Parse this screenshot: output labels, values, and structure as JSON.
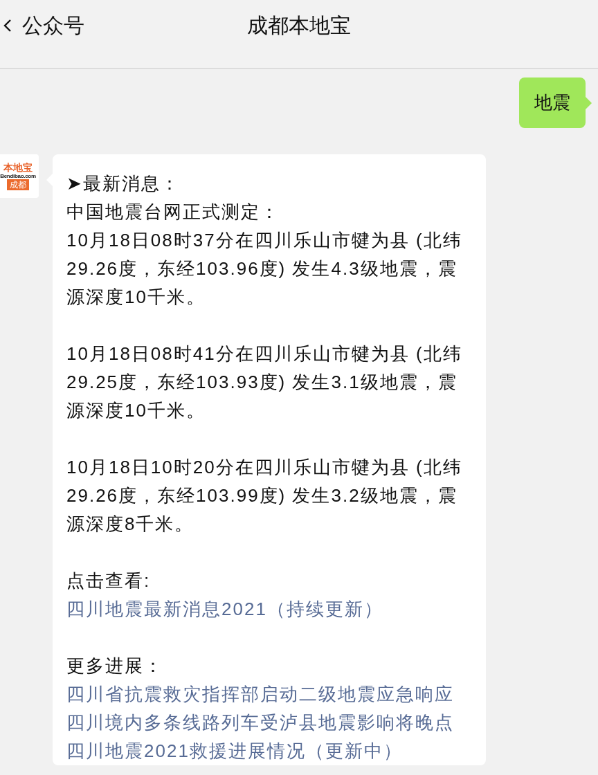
{
  "header": {
    "back_label": "公众号",
    "title": "成都本地宝"
  },
  "messages": [
    {
      "kind": "outgoing",
      "text": "地震"
    },
    {
      "kind": "incoming",
      "avatar": {
        "logo_name": "本地宝",
        "logo_domain": "Bendibao.com",
        "logo_city": "成都"
      },
      "paragraphs": [
        [
          {
            "kind": "text",
            "text": "➤最新消息："
          },
          {
            "kind": "text",
            "text": "中国地震台网正式测定："
          },
          {
            "kind": "text",
            "text": "10月18日08时37分在四川乐山市犍为县 (北纬29.26度，东经103.96度) 发生4.3级地震，震源深度10千米。"
          }
        ],
        [
          {
            "kind": "text",
            "text": "10月18日08时41分在四川乐山市犍为县 (北纬29.25度，东经103.93度) 发生3.1级地震，震源深度10千米。"
          }
        ],
        [
          {
            "kind": "text",
            "text": "10月18日10时20分在四川乐山市犍为县 (北纬29.26度，东经103.99度) 发生3.2级地震，震源深度8千米。"
          }
        ],
        [
          {
            "kind": "text",
            "text": "点击查看:"
          },
          {
            "kind": "link",
            "text": "四川地震最新消息2021（持续更新）"
          }
        ],
        [
          {
            "kind": "text",
            "text": "更多进展："
          },
          {
            "kind": "link",
            "text": "四川省抗震救灾指挥部启动二级地震应急响应"
          },
          {
            "kind": "link",
            "text": "四川境内多条线路列车受泸县地震影响将晚点"
          },
          {
            "kind": "link",
            "text": "四川地震2021救援进展情况（更新中）"
          }
        ]
      ]
    }
  ]
}
